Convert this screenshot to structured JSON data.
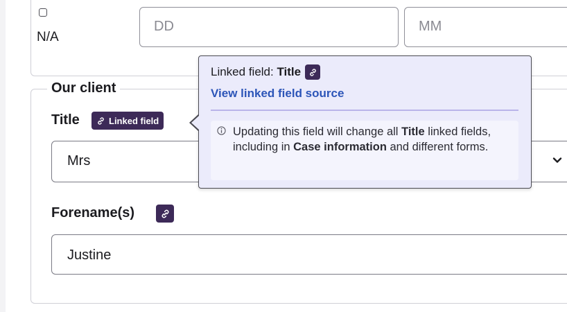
{
  "date_section": {
    "na_label": "N/A",
    "day_placeholder": "DD",
    "month_placeholder": "MM"
  },
  "client_section": {
    "legend": "Our client",
    "title_label": "Title",
    "linked_badge": "Linked field",
    "title_value": "Mrs",
    "forename_label": "Forename(s)",
    "forename_value": "Justine"
  },
  "tooltip": {
    "heading_prefix": "Linked field: ",
    "heading_field": "Title",
    "source_link": "View linked field source",
    "message": {
      "part1": "Updating this field will change all ",
      "field": "Title",
      "part2": " linked fields, including in ",
      "location": "Case information",
      "part3": " and different forms."
    }
  },
  "colors": {
    "badge_bg": "#3d2a58",
    "tooltip_bg": "#ebebfb",
    "link_text": "#2c55b8"
  }
}
